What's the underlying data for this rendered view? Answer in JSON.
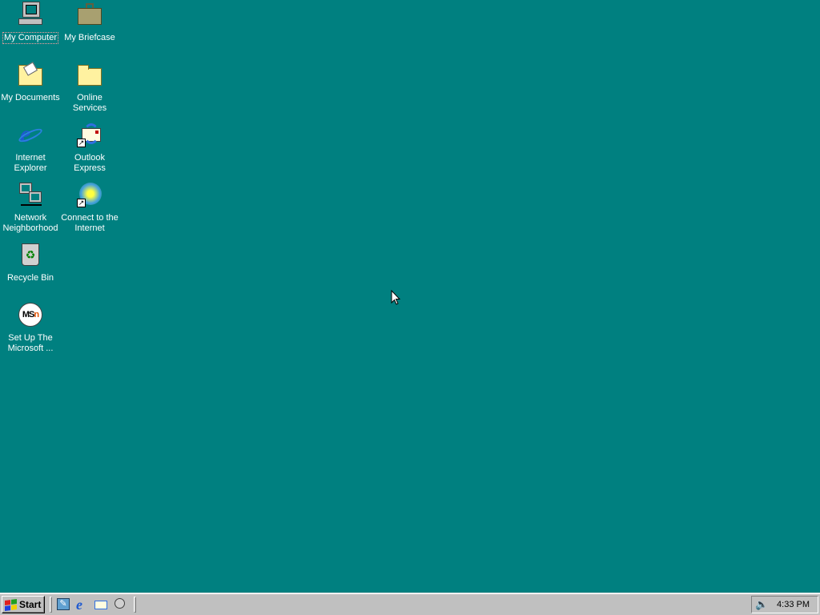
{
  "desktop": {
    "icons": [
      {
        "label": "My Computer"
      },
      {
        "label": "My Briefcase"
      },
      {
        "label": "My Documents"
      },
      {
        "label": "Online Services"
      },
      {
        "label": "Internet Explorer"
      },
      {
        "label": "Outlook Express"
      },
      {
        "label": "Network Neighborhood"
      },
      {
        "label": "Connect to the Internet"
      },
      {
        "label": "Recycle Bin"
      },
      {
        "label": "Set Up The Microsoft ..."
      }
    ],
    "background": "#008080"
  },
  "taskbar": {
    "start_label": "Start",
    "quick_launch": [
      "show-desktop",
      "internet-explorer",
      "outlook-express",
      "channels"
    ],
    "clock": "4:33 PM"
  }
}
